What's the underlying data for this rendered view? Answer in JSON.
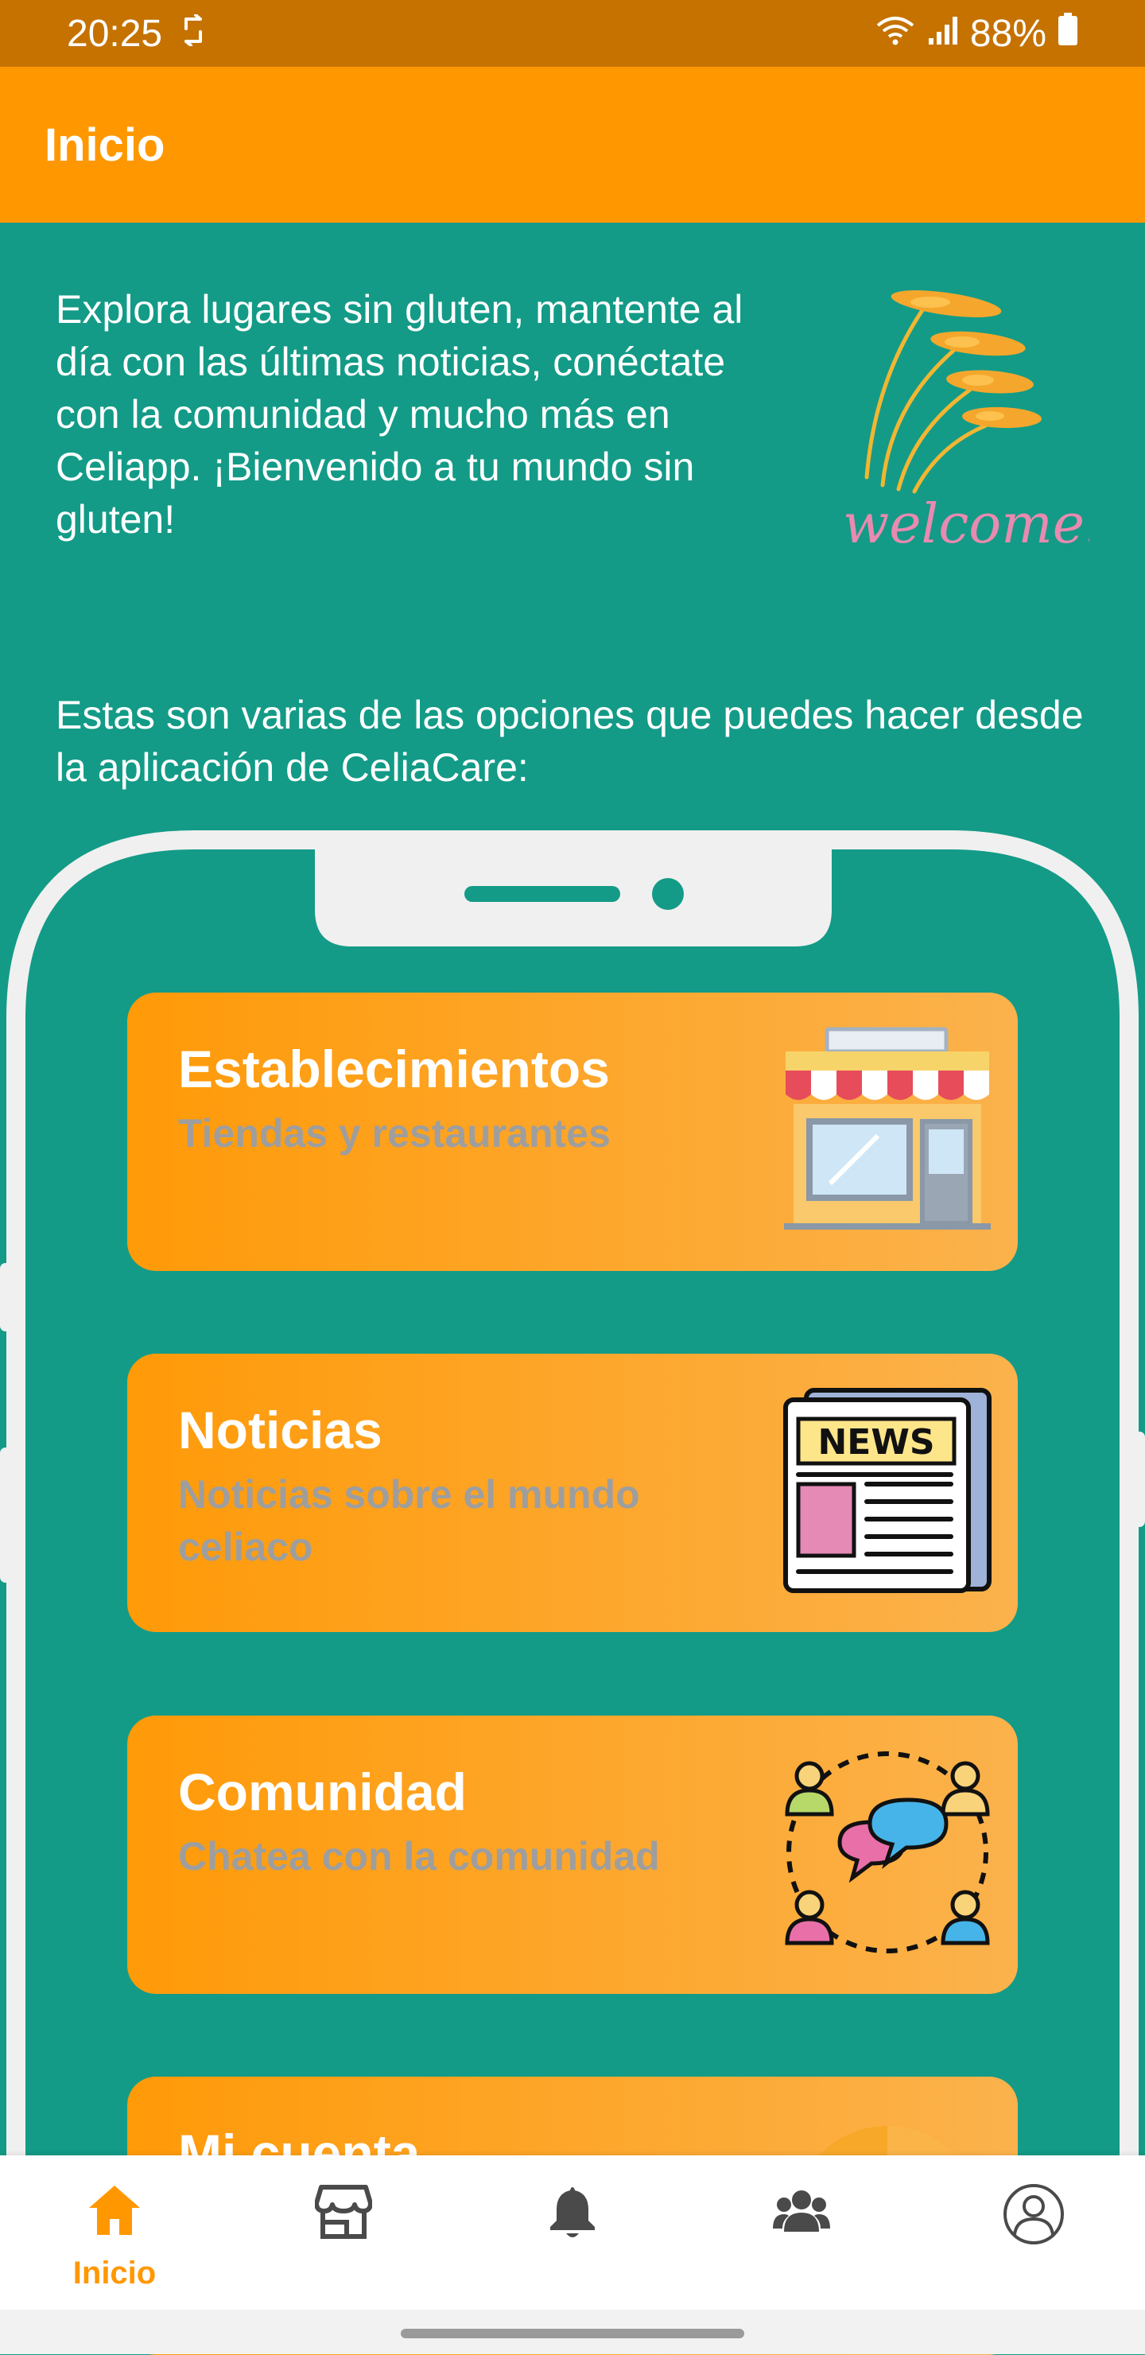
{
  "status_bar": {
    "time": "20:25",
    "battery": "88%"
  },
  "app_bar": {
    "title": "Inicio"
  },
  "intro": {
    "text": "Explora lugares sin gluten, mantente al día con las últimas noticias, conéctate con la comunidad y mucho más en Celiapp. ¡Bienvenido a tu mundo sin gluten!"
  },
  "welcome_image": {
    "text": "welcome!"
  },
  "options": {
    "text": "Estas son varias de las opciones que puedes hacer desde la aplicación de CeliaCare:"
  },
  "cards": [
    {
      "title": "Establecimientos",
      "subtitle": "Tiendas y restaurantes",
      "icon": "store-icon"
    },
    {
      "title": "Noticias",
      "subtitle": "Noticias sobre el mundo celiaco",
      "icon": "news-icon",
      "icon_text": "NEWS"
    },
    {
      "title": "Comunidad",
      "subtitle": "Chatea con la comunidad",
      "icon": "community-chat-icon"
    },
    {
      "title": "Mi cuenta",
      "subtitle": "",
      "icon": "account-icon"
    }
  ],
  "bottom_nav": [
    {
      "label": "Inicio",
      "icon": "home-icon",
      "active": true
    },
    {
      "icon": "store-icon"
    },
    {
      "icon": "bell-icon"
    },
    {
      "icon": "community-icon"
    },
    {
      "icon": "profile-icon"
    }
  ],
  "colors": {
    "status_bar": "#C57200",
    "app_bar": "#FF9800",
    "background": "#139B87",
    "card_gradient_start": "#FF9A08",
    "card_gradient_end": "#FBB24C",
    "subtitle": "#9E9E9E",
    "nav_active": "#FF9800",
    "nav_inactive": "#4A4A4A"
  }
}
